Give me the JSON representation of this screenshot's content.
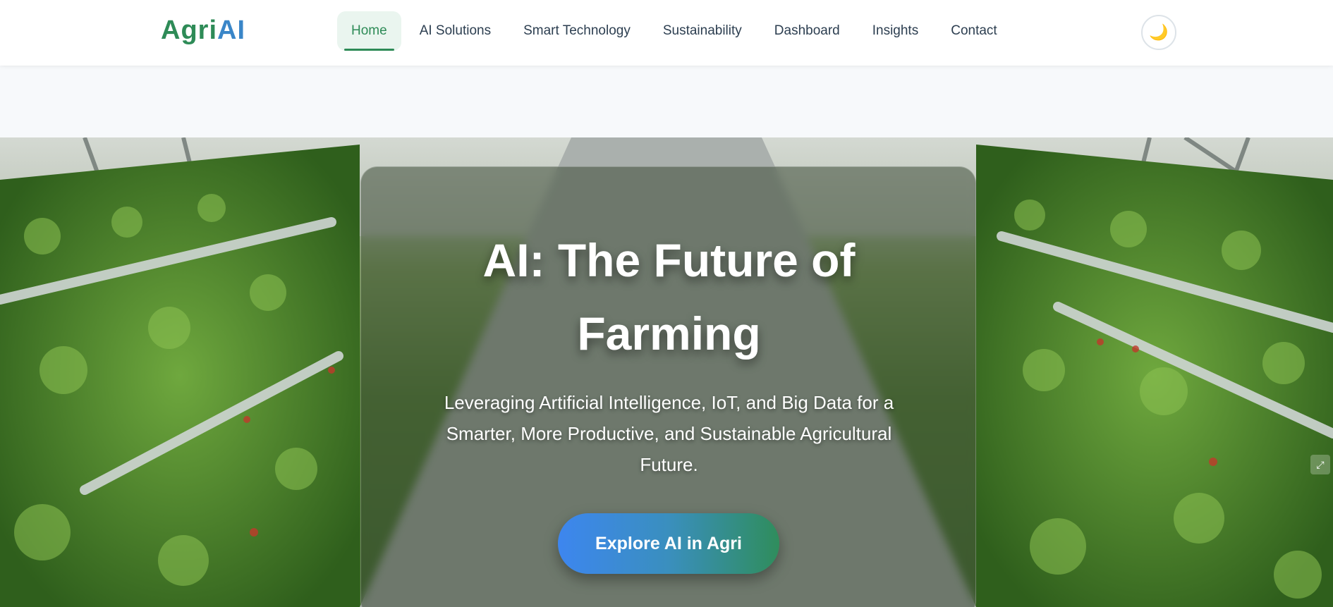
{
  "brand": {
    "part1": "Agri",
    "part2": "AI"
  },
  "nav": {
    "items": [
      {
        "label": "Home",
        "active": true
      },
      {
        "label": "AI Solutions"
      },
      {
        "label": "Smart Technology"
      },
      {
        "label": "Sustainability"
      },
      {
        "label": "Dashboard"
      },
      {
        "label": "Insights"
      },
      {
        "label": "Contact"
      }
    ],
    "theme_toggle_icon": "moon-icon",
    "theme_toggle_glyph": "🌙"
  },
  "hero": {
    "title": "AI: The Future of Farming",
    "subtitle": "Leveraging Artificial Intelligence, IoT, and Big Data for a Smarter, More Productive, and Sustainable Agricultural Future.",
    "cta_label": "Explore AI in Agri",
    "background": "greenhouse-strawberry-rows-image"
  },
  "colors": {
    "brand_green": "#2e8b57",
    "brand_blue": "#3a86c8",
    "cta_start": "#3d86ef",
    "cta_end": "#2f8d5c"
  }
}
